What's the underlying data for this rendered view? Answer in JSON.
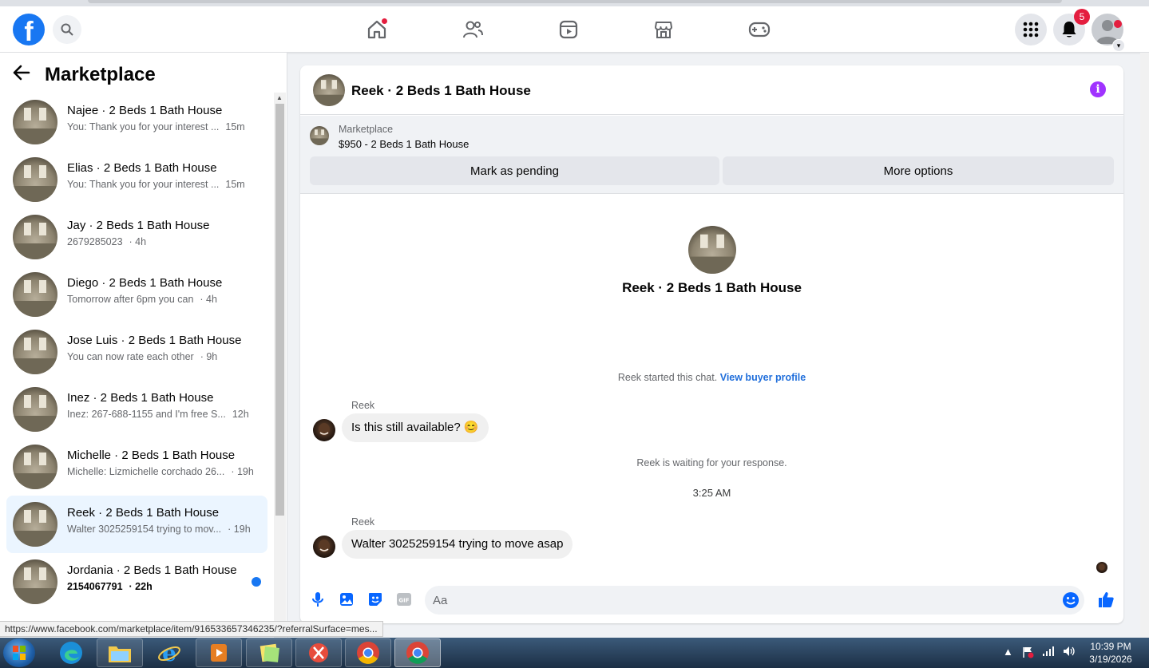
{
  "topnav": {
    "notifications_badge": "5"
  },
  "sidebar": {
    "title": "Marketplace",
    "conversations": [
      {
        "name": "Najee · 2 Beds 1 Bath House",
        "preview": "You: Thank you for your interest ...",
        "time": "15m"
      },
      {
        "name": "Elias · 2 Beds 1 Bath House",
        "preview": "You: Thank you for your interest ...",
        "time": "15m"
      },
      {
        "name": "Jay · 2 Beds 1 Bath House",
        "preview": "2679285023",
        "time": "· 4h"
      },
      {
        "name": "Diego · 2 Beds 1 Bath House",
        "preview": "Tomorrow after 6pm you can",
        "time": "· 4h"
      },
      {
        "name": "Jose Luis · 2 Beds 1 Bath House",
        "preview": "You can now rate each other",
        "time": "· 9h"
      },
      {
        "name": "Inez · 2 Beds 1 Bath House",
        "preview": "Inez: 267-688-1155 and I'm free S...",
        "time": "12h"
      },
      {
        "name": "Michelle · 2 Beds 1 Bath House",
        "preview": "Michelle: Lizmichelle corchado 26...",
        "time": "· 19h"
      },
      {
        "name": "Reek · 2 Beds 1 Bath House",
        "preview": "Walter 3025259154 trying to mov...",
        "time": "· 19h"
      },
      {
        "name": "Jordania · 2 Beds 1 Bath House",
        "preview": "2154067791",
        "time": "· 22h"
      }
    ]
  },
  "chat": {
    "title": "Reek · 2 Beds 1 Bath House",
    "listing_label": "Marketplace",
    "listing_price": "$950 - 2 Beds 1 Bath House",
    "mark_pending_label": "Mark as pending",
    "more_options_label": "More options",
    "intro_name": "Reek · 2 Beds 1 Bath House",
    "started_text": "Reek started this chat.",
    "view_profile_label": "View buyer profile",
    "sender_name": "Reek",
    "message_1": "Is this still available? 😊",
    "waiting_text": "Reek is waiting for your response.",
    "timestamp": "3:25 AM",
    "message_2": "Walter 3025259154 trying to move asap",
    "composer_placeholder": "Aa"
  },
  "status_url": "https://www.facebook.com/marketplace/item/916533657346235/?referralSurface=mes...",
  "taskbar": {
    "time": "10:39 PM",
    "date": "3/19/2026"
  },
  "colors": {
    "brand": "#1877f2",
    "accent_info": "#a033ff",
    "link": "#216fdb",
    "badge": "#e41e3f",
    "active_row": "#ebf5ff"
  }
}
